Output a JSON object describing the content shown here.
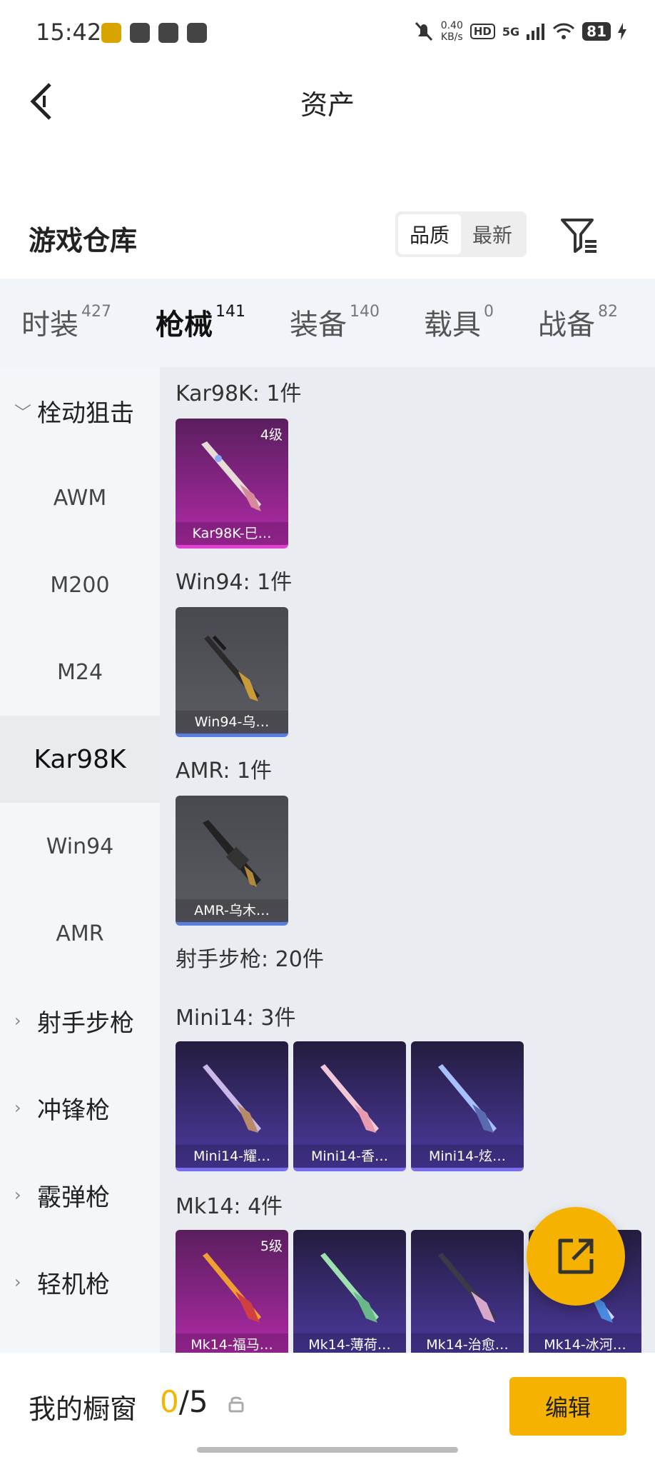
{
  "status_bar": {
    "time": "15:42",
    "net_speed_value": "0.40",
    "net_speed_unit": "KB/s",
    "hd": "HD",
    "signal": "5G",
    "battery": "81"
  },
  "header": {
    "title": "资产"
  },
  "warehouse": {
    "title": "游戏仓库",
    "sort_quality": "品质",
    "sort_latest": "最新"
  },
  "tabs": [
    {
      "label": "时装",
      "count": "427"
    },
    {
      "label": "枪械",
      "count": "141"
    },
    {
      "label": "装备",
      "count": "140"
    },
    {
      "label": "载具",
      "count": "0"
    },
    {
      "label": "战备",
      "count": "82"
    }
  ],
  "sidebar": {
    "items": [
      {
        "label": "栓动狙击"
      },
      {
        "label": "AWM"
      },
      {
        "label": "M200"
      },
      {
        "label": "M24"
      },
      {
        "label": "Kar98K"
      },
      {
        "label": "Win94"
      },
      {
        "label": "AMR"
      },
      {
        "label": "射手步枪"
      },
      {
        "label": "冲锋枪"
      },
      {
        "label": "霰弹枪"
      },
      {
        "label": "轻机枪"
      }
    ]
  },
  "groups": {
    "kar98k": {
      "title": "Kar98K: 1件",
      "items": [
        {
          "name": "Kar98K-巳…",
          "level": "4级"
        }
      ]
    },
    "win94": {
      "title": "Win94: 1件",
      "items": [
        {
          "name": "Win94-乌…"
        }
      ]
    },
    "amr": {
      "title": "AMR: 1件",
      "items": [
        {
          "name": "AMR-乌木…"
        }
      ]
    },
    "marksman": {
      "title": "射手步枪: 20件"
    },
    "mini14": {
      "title": "Mini14: 3件",
      "items": [
        {
          "name": "Mini14-耀…"
        },
        {
          "name": "Mini14-香…"
        },
        {
          "name": "Mini14-炫…"
        }
      ]
    },
    "mk14": {
      "title": "Mk14: 4件",
      "items": [
        {
          "name": "Mk14-福马…",
          "level": "5级"
        },
        {
          "name": "Mk14-薄荷…"
        },
        {
          "name": "Mk14-治愈…"
        },
        {
          "name": "Mk14-冰河…"
        }
      ]
    }
  },
  "bottom": {
    "showcase_label": "我的橱窗",
    "showcase_current": "0",
    "showcase_total": "/5",
    "edit_label": "编辑"
  }
}
